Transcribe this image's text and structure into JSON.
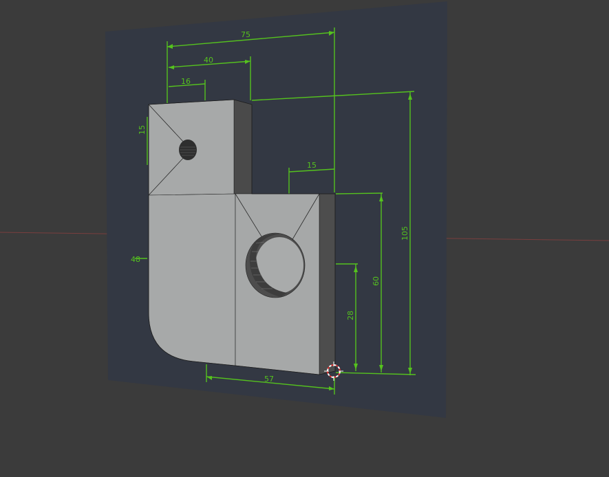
{
  "viewport": {
    "background": "#3b3b3b",
    "sheet_color": "#333843",
    "dim_color": "#55c21e",
    "part_color": "#a7a9a9",
    "part_side_color": "#4d4d4d",
    "x_axis_color": "#8a3f3f"
  },
  "drawing": {
    "dims": {
      "overall_width": "75",
      "upper_width": "40",
      "top_offset": "16",
      "hole_offset": "15",
      "slot_width": "15",
      "left_height": "48",
      "overall_height": "105",
      "right_height": "60",
      "lower_height": "28",
      "bottom_width": "57"
    }
  },
  "cursor": {
    "icon": "3d-cursor-icon"
  }
}
